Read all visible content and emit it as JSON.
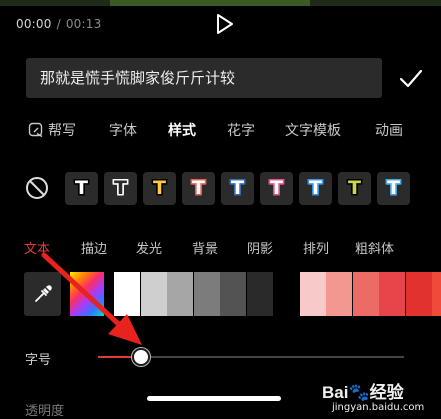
{
  "player": {
    "current_time": "00:00",
    "separator": "/",
    "total_time": "00:13"
  },
  "caption": {
    "text": "那就是慌手慌脚家俊斤斤计较"
  },
  "tabs": [
    {
      "label": "帮写",
      "icon": "ai-write-icon",
      "active": false
    },
    {
      "label": "字体",
      "active": false
    },
    {
      "label": "样式",
      "active": true
    },
    {
      "label": "花字",
      "active": false
    },
    {
      "label": "文字模板",
      "active": false
    },
    {
      "label": "动画",
      "active": false
    }
  ],
  "style_presets": [
    {
      "fill": "#ffffff",
      "stroke": "#000000"
    },
    {
      "fill": "#2b2b2b",
      "stroke": "#ffffff"
    },
    {
      "fill": "#ffc83d",
      "stroke": "#000000"
    },
    {
      "fill": "#ffffff",
      "stroke": "#e8614f"
    },
    {
      "fill": "#ffffff",
      "stroke": "#3b6fb3"
    },
    {
      "fill": "#ffffff",
      "stroke": "#e8508c"
    },
    {
      "fill": "#ffffff",
      "stroke": "#3a95e6"
    },
    {
      "fill": "#c8d84a",
      "stroke": "#000000"
    },
    {
      "fill": "#ffffff",
      "stroke": "#4aa5e6"
    }
  ],
  "preset_glyph": "T",
  "subtabs": [
    {
      "label": "文本",
      "active": true
    },
    {
      "label": "描边",
      "active": false
    },
    {
      "label": "发光",
      "active": false
    },
    {
      "label": "背景",
      "active": false
    },
    {
      "label": "阴影",
      "active": false
    },
    {
      "label": "排列",
      "active": false
    },
    {
      "label": "粗斜体",
      "active": false
    }
  ],
  "color_swatches": [
    "#ffffff",
    "#cfcfcf",
    "#a6a6a6",
    "#7c7c7c",
    "#535353",
    "#2a2a2a",
    "#000000",
    "#f7c9c9",
    "#f29891",
    "#ec6b64",
    "#e8454a",
    "#e1322d",
    "#f04a3a"
  ],
  "font_size": {
    "label": "字号",
    "value": 0.14
  },
  "next_label": "透明度",
  "watermark": {
    "logo_left": "Bai",
    "logo_right": "经验",
    "url": "jingyan.baidu.com"
  },
  "colors": {
    "accent": "#e23a3a",
    "annotation_arrow": "#e8231f"
  }
}
